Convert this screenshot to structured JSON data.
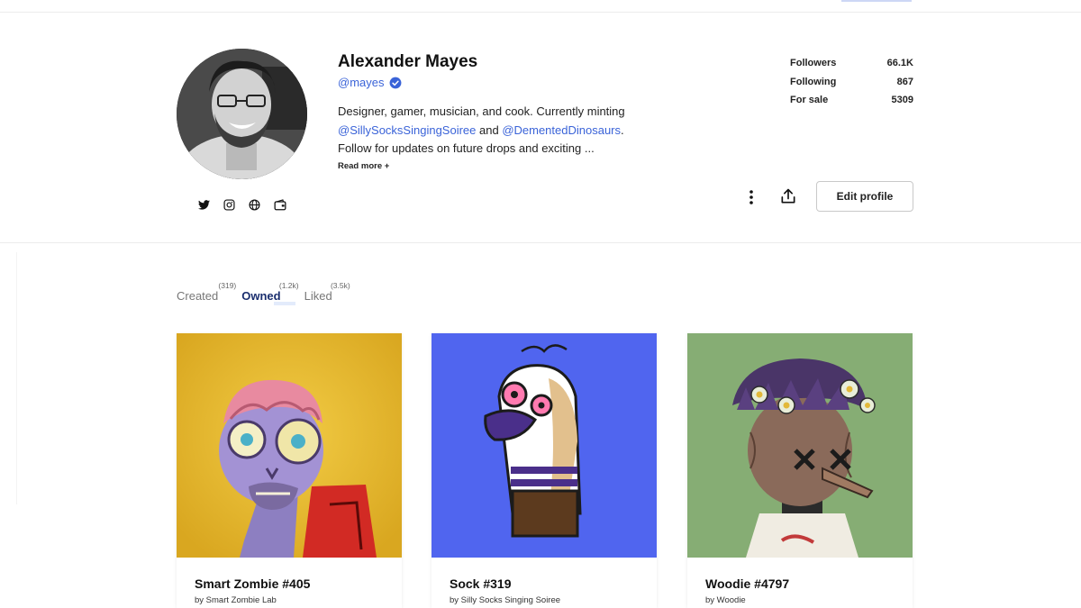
{
  "colors": {
    "accent": "#3a63d8",
    "card1_bg": "#e6b831",
    "card2_bg": "#5065ef",
    "card3_bg": "#86ad74"
  },
  "profile": {
    "name": "Alexander Mayes",
    "handle": "@mayes",
    "verified_icon": "verified-badge-icon",
    "bio_line1": "Designer, gamer, musician, and cook. Currently minting",
    "bio_mention1": "@SillySocksSingingSoiree",
    "bio_and": " and ",
    "bio_mention2": "@DementedDinosaurs",
    "bio_dot": ".",
    "bio_line3": "Follow for updates on future drops and exciting ...",
    "read_more": "Read more +",
    "socials": [
      "twitter-icon",
      "instagram-icon",
      "globe-icon",
      "wallet-icon"
    ]
  },
  "stats": [
    {
      "label": "Followers",
      "value": "66.1K"
    },
    {
      "label": "Following",
      "value": "867"
    },
    {
      "label": "For sale",
      "value": "5309"
    }
  ],
  "actions": {
    "more_icon": "more-vertical-icon",
    "share_icon": "share-icon",
    "edit_label": "Edit profile"
  },
  "tabs": [
    {
      "label": "Created",
      "count": "(319)",
      "active": false
    },
    {
      "label": "Owned",
      "count": "(1.2k)",
      "active": true
    },
    {
      "label": "Liked",
      "count": "(3.5k)",
      "active": false
    }
  ],
  "cards": [
    {
      "title": "Smart Zombie #405",
      "by": "by Smart Zombie Lab"
    },
    {
      "title": "Sock #319",
      "by": "by Silly Socks Singing Soiree"
    },
    {
      "title": "Woodie #4797",
      "by": "by Woodie"
    }
  ]
}
